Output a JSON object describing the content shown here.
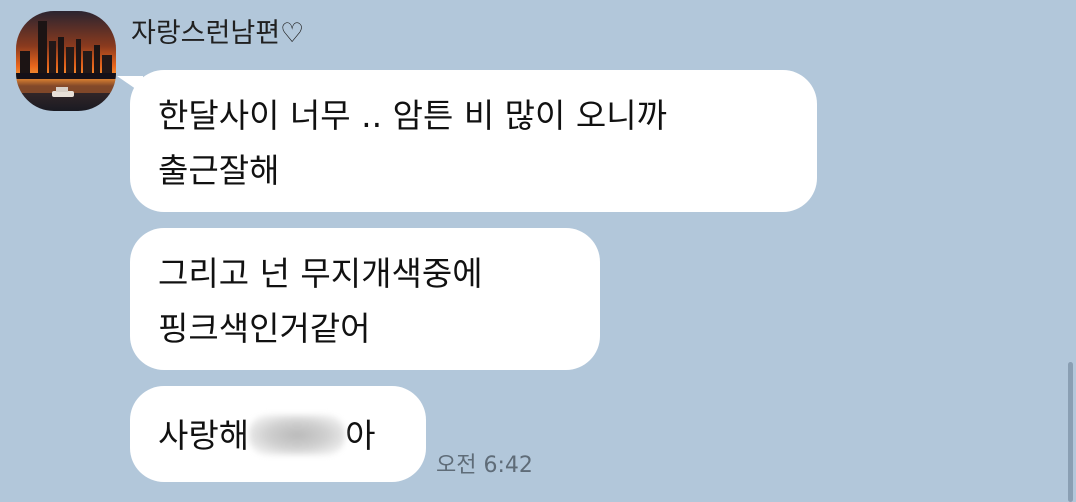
{
  "sender": {
    "name": "자랑스런남편♡"
  },
  "messages": [
    {
      "lines": [
        "한달사이 너무 .. 암튼 비 많이 오니까",
        "출근잘해"
      ]
    },
    {
      "lines": [
        "그리고 넌 무지개색중에",
        "핑크색인거같어"
      ]
    },
    {
      "before": "사랑해",
      "after": "아"
    }
  ],
  "timestamp": "오전 6:42",
  "colors": {
    "background": "#b2c7da",
    "bubble": "#ffffff",
    "timestamp": "#5f6c78"
  },
  "icons": {
    "avatar": "city-sunset-avatar"
  }
}
